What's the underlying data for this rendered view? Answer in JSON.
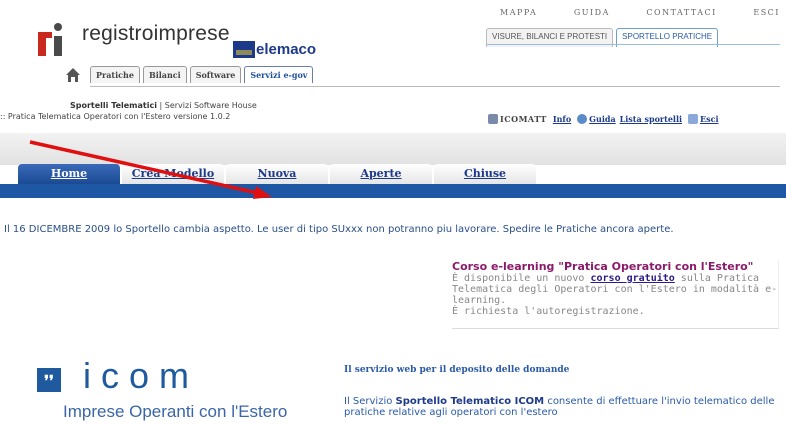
{
  "header": {
    "logo_text": "registroimprese",
    "partner_logo_text": "elemaco",
    "top_links": [
      "MAPPA",
      "GUIDA",
      "CONTATTACI",
      "ESCI"
    ],
    "service_tabs": [
      "VISURE, BILANCI E PROTESTI",
      "SPORTELLO PRATICHE"
    ],
    "active_service_tab": 1,
    "mini_tabs": [
      "Pratiche",
      "Bilanci",
      "Software",
      "Servizi e-gov"
    ],
    "active_mini_tab": 3
  },
  "subheader": {
    "line1_bold": "Sportelli Telematici",
    "line1_rest": " | Servizi Software House",
    "line2": ":: Pratica Telematica Operatori con l'Estero versione 1.0.2",
    "tools": {
      "icomatt": "ICOMATT",
      "info": "Info",
      "guida": "Guida",
      "lista": "Lista sportelli",
      "esci": "Esci"
    }
  },
  "nav": {
    "tabs": [
      "Home",
      "Crea Modello",
      "Nuova",
      "Aperte",
      "Chiuse"
    ],
    "active": 0
  },
  "notice": "Il 16 DICEMBRE 2009 lo Sportello cambia aspetto. Le user di tipo SUxxx non potranno piu lavorare. Spedire le Pratiche ancora aperte.",
  "course": {
    "title": "Corso e-learning \"Pratica Operatori con l'Estero\"",
    "body_pre": "È disponibile un nuovo ",
    "link": "corso gratuito",
    "body_post": " sulla Pratica Telematica degli Operatori con l'Estero in modalità e-learning.",
    "note": "È richiesta l'autoregistrazione."
  },
  "footer": {
    "icom_mark": "❜❜",
    "icom_word": "icom",
    "icom_tagline": "Imprese Operanti con l'Estero",
    "web_title": "Il servizio web per il deposito delle domande",
    "web_pre": "Il Servizio ",
    "web_bold": "Sportello Telematico ICOM",
    "web_post": " consente di effettuare l'invio telematico delle pratiche relative agli operatori con l'estero"
  },
  "colors": {
    "brand_blue": "#1e57a4",
    "logo_red": "#c8281e",
    "arrow_red": "#e01010",
    "course_title": "#8a1a6a"
  }
}
